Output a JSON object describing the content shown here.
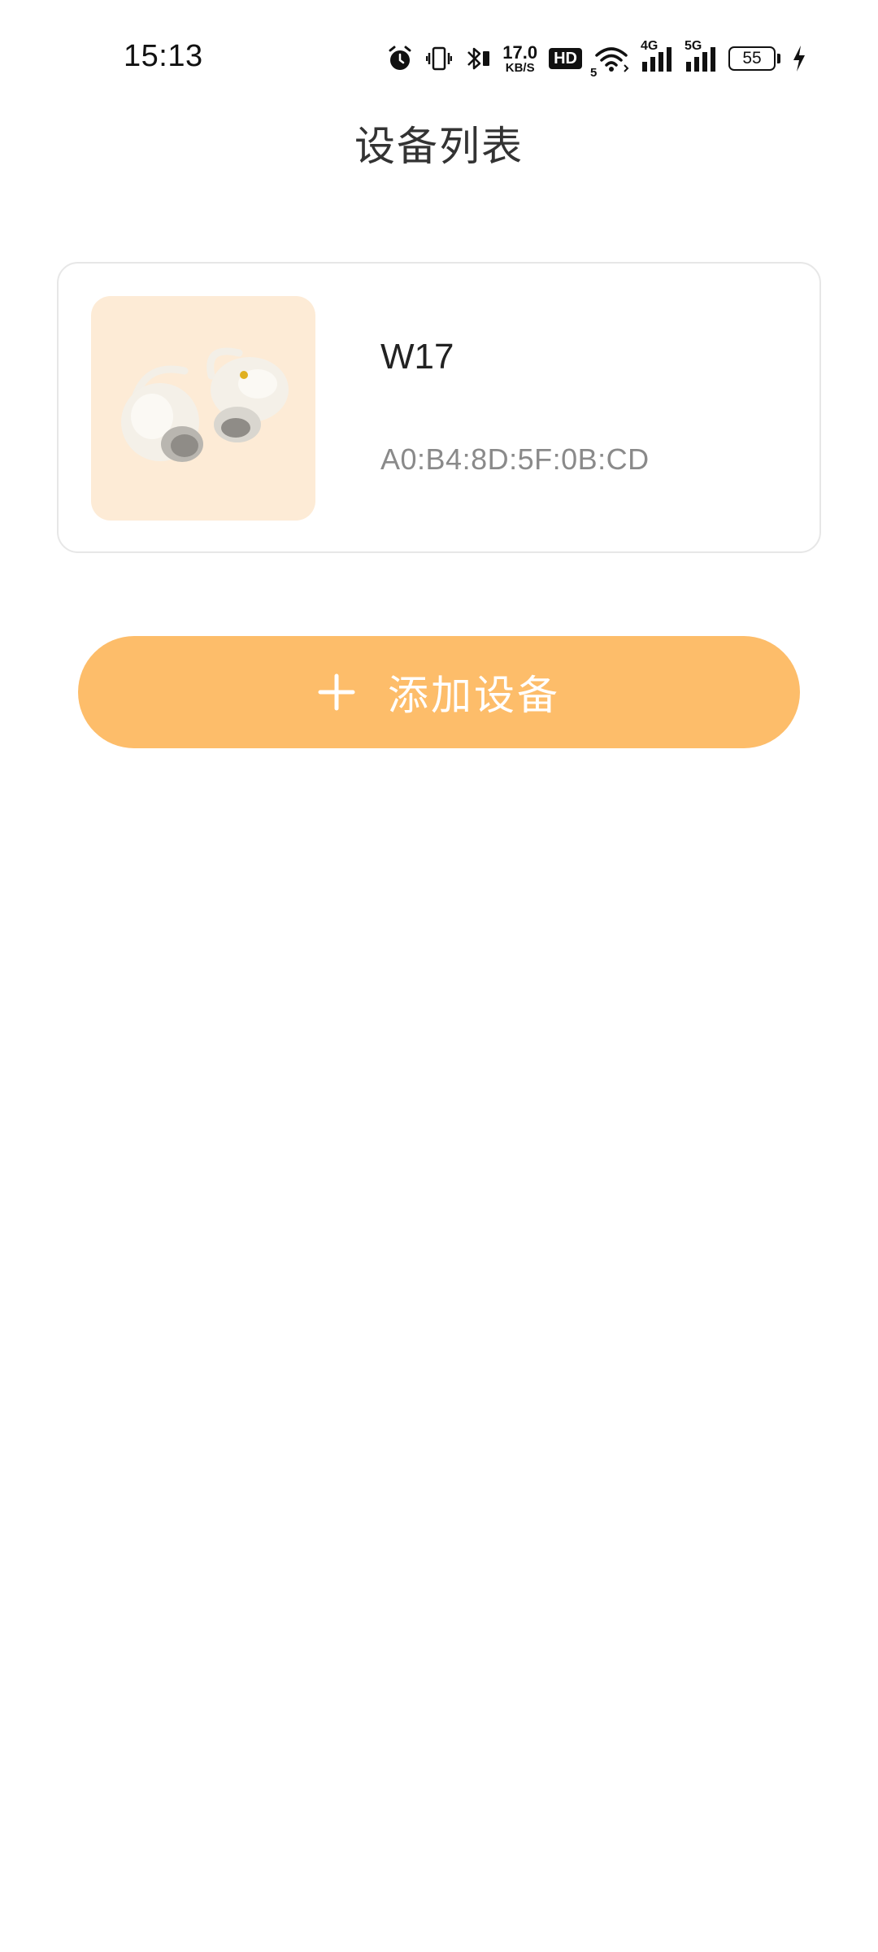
{
  "status_bar": {
    "time": "15:13",
    "net_speed_value": "17.0",
    "net_speed_unit": "KB/S",
    "hd_label": "HD",
    "wifi_sub": "5",
    "net_4g": "4G",
    "net_5g": "5G",
    "battery": "55",
    "icons": [
      "alarm-icon",
      "vibrate-icon",
      "bluetooth-icon",
      "hd-icon",
      "wifi-icon",
      "signal-4g-icon",
      "signal-5g-icon",
      "battery-icon",
      "charging-icon"
    ]
  },
  "header": {
    "title": "设备列表"
  },
  "devices": [
    {
      "name": "W17",
      "mac": "A0:B4:8D:5F:0B:CD",
      "image": "earbuds-image"
    }
  ],
  "actions": {
    "add_device_label": "添加设备",
    "add_icon": "plus-icon"
  },
  "colors": {
    "accent": "#fdbd6a",
    "thumb_bg": "#fdebd6",
    "card_border": "#e7e7e7",
    "mac_text": "#8a8a8a"
  }
}
